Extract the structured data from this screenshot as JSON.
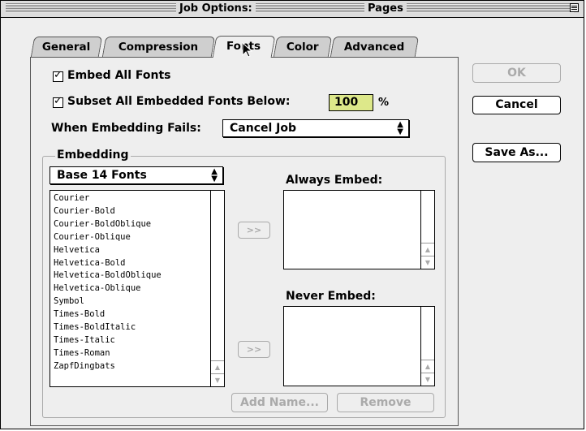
{
  "window": {
    "title": "Job Options:",
    "title_right": "Pages"
  },
  "tabs": [
    {
      "label": "General",
      "active": false
    },
    {
      "label": "Compression",
      "active": false
    },
    {
      "label": "Fonts",
      "active": true
    },
    {
      "label": "Color",
      "active": false
    },
    {
      "label": "Advanced",
      "active": false
    }
  ],
  "options": {
    "embed_all_fonts": {
      "label": "Embed All Fonts",
      "checked": true
    },
    "subset_fonts": {
      "label": "Subset All Embedded Fonts Below:",
      "checked": true,
      "value": "100",
      "unit": "%"
    },
    "when_embedding_fails": {
      "label": "When Embedding Fails:",
      "selected": "Cancel Job"
    }
  },
  "embedding": {
    "title": "Embedding",
    "font_source": "Base 14 Fonts",
    "fonts": [
      "Courier",
      "Courier-Bold",
      "Courier-BoldOblique",
      "Courier-Oblique",
      "Helvetica",
      "Helvetica-Bold",
      "Helvetica-BoldOblique",
      "Helvetica-Oblique",
      "Symbol",
      "Times-Bold",
      "Times-BoldItalic",
      "Times-Italic",
      "Times-Roman",
      "ZapfDingbats"
    ],
    "always_embed_label": "Always Embed:",
    "never_embed_label": "Never Embed:",
    "move_button_label": ">>",
    "add_name_label": "Add Name...",
    "remove_label": "Remove"
  },
  "buttons": {
    "ok": "OK",
    "cancel": "Cancel",
    "save_as": "Save As..."
  }
}
